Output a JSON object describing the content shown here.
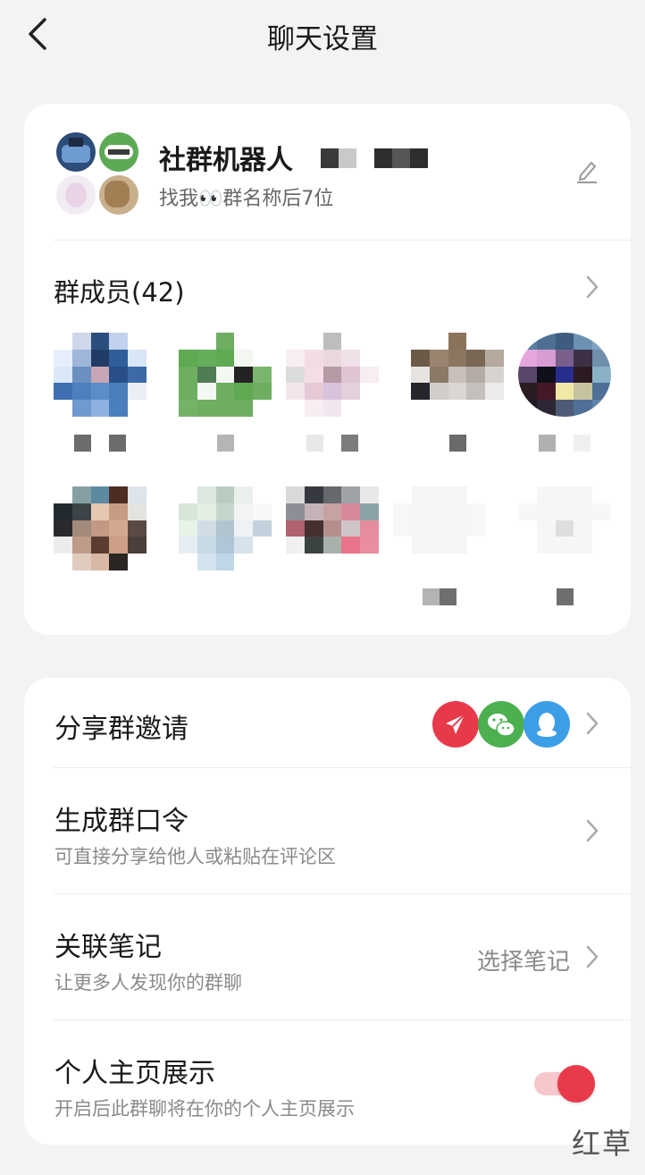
{
  "header": {
    "title": "聊天设置",
    "back_icon": "chevron-left-icon"
  },
  "group": {
    "name": "社群机器人",
    "description": "找我👀群名称后7位",
    "edit_icon": "pencil-icon"
  },
  "members": {
    "title": "群成员(42)",
    "count": 42
  },
  "settings": {
    "share_invite": {
      "label": "分享群邀请",
      "share_targets": [
        "red-send-icon",
        "wechat-icon",
        "qq-icon"
      ]
    },
    "group_code": {
      "label": "生成群口令",
      "subtitle": "可直接分享给他人或粘贴在评论区"
    },
    "linked_notes": {
      "label": "关联笔记",
      "subtitle": "让更多人发现你的群聊",
      "value": "选择笔记"
    },
    "profile_display": {
      "label": "个人主页展示",
      "subtitle": "开启后此群聊将在你的个人主页展示",
      "enabled": true
    }
  },
  "watermark": "红草",
  "colors": {
    "accent": "#e83a4b",
    "background": "#f3f3f3"
  }
}
